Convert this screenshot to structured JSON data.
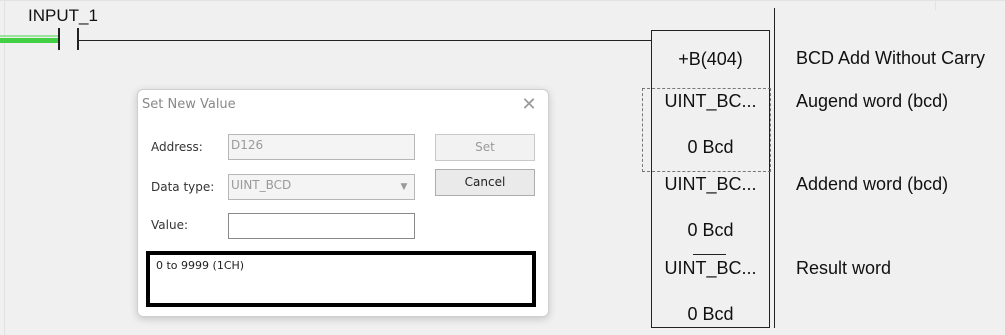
{
  "ladder": {
    "contact_label": "INPUT_1",
    "instruction": {
      "mnemonic": "+B(404)",
      "operand1_type": "UINT_BC...",
      "operand1_value": "0 Bcd",
      "operand2_type": "UINT_BC...",
      "operand2_value": "0 Bcd",
      "operand3_type": "UINT_BC...",
      "operand3_value": "0 Bcd"
    },
    "descriptions": {
      "title": "BCD Add Without Carry",
      "augend": "Augend word (bcd)",
      "addend": "Addend word (bcd)",
      "result": "Result word"
    },
    "power_color": "#44d044"
  },
  "dialog": {
    "title": "Set New Value",
    "close_icon": "close-icon",
    "address_label": "Address:",
    "address_value": "D126",
    "datatype_label": "Data type:",
    "datatype_value": "UINT_BCD",
    "value_label": "Value:",
    "value_value": "",
    "set_label": "Set",
    "cancel_label": "Cancel",
    "range_text": "0 to 9999 (1CH)"
  }
}
